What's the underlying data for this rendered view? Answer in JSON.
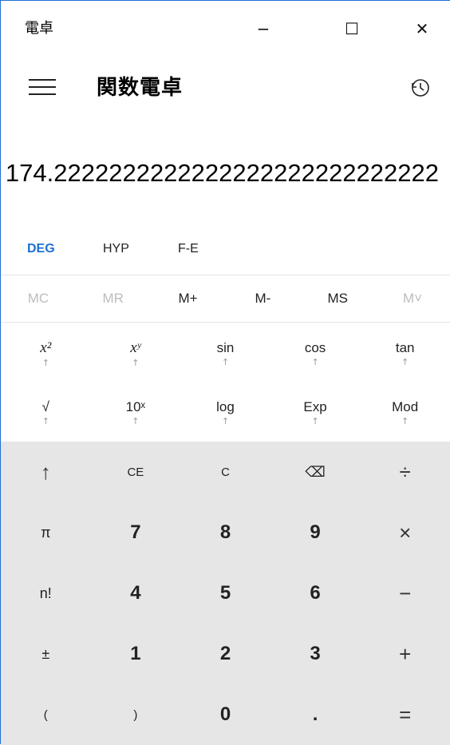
{
  "window": {
    "title": "電卓",
    "min_glyph": "−",
    "max_glyph": "☐",
    "close_glyph": "✕"
  },
  "header": {
    "mode_title": "関数電卓"
  },
  "display": {
    "value": "174.2222222222222222222222222222"
  },
  "angle_row": {
    "deg": "DEG",
    "hyp": "HYP",
    "fe": "F-E"
  },
  "memory_row": {
    "mc": "MC",
    "mr": "MR",
    "mplus": "M+",
    "mminus": "M-",
    "ms": "MS",
    "mlist": "M˅"
  },
  "sci_row1": {
    "x2": "x²",
    "xy": "xʸ",
    "sin": "sin",
    "cos": "cos",
    "tan": "tan",
    "arrow": "↑"
  },
  "sci_row2": {
    "sqrt": "√",
    "tenx": "10ˣ",
    "log": "log",
    "exp": "Exp",
    "mod": "Mod"
  },
  "keypad": {
    "shift": "↑",
    "ce": "CE",
    "c": "C",
    "backspace": "⌫",
    "divide": "÷",
    "pi": "π",
    "n7": "7",
    "n8": "8",
    "n9": "9",
    "multiply": "×",
    "fact": "n!",
    "n4": "4",
    "n5": "5",
    "n6": "6",
    "minus": "−",
    "plusminus": "±",
    "n1": "1",
    "n2": "2",
    "n3": "3",
    "plus": "+",
    "lparen": "(",
    "rparen": ")",
    "n0": "0",
    "dot": ".",
    "equals": "="
  }
}
